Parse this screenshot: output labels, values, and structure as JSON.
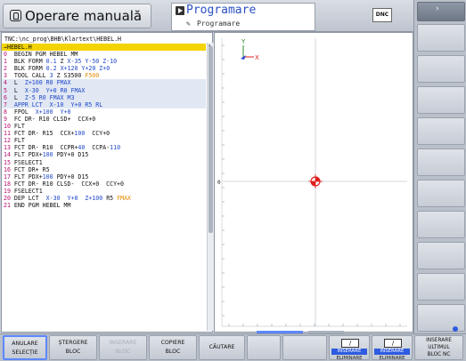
{
  "header": {
    "mode_left_label": "Operare manuală",
    "mode_active_label": "Programare",
    "mode_active_sub": "Programare",
    "dnc_badge": "DNC"
  },
  "program": {
    "path": "TNC:\\nc_prog\\BHB\\Klartext\\HEBEL.H",
    "lines": [
      [
        {
          "t": "→HEBEL.H",
          "c": ""
        }
      ],
      [
        {
          "t": "0  ",
          "c": "n"
        },
        {
          "t": "BEGIN PGM HEBEL MM",
          "c": ""
        }
      ],
      [
        {
          "t": "1  ",
          "c": "n"
        },
        {
          "t": "BLK FORM ",
          "c": ""
        },
        {
          "t": "0.1",
          "c": "v"
        },
        {
          "t": " Z ",
          "c": ""
        },
        {
          "t": "X-35",
          "c": "v"
        },
        {
          "t": " ",
          "c": ""
        },
        {
          "t": "Y-50",
          "c": "v"
        },
        {
          "t": " ",
          "c": ""
        },
        {
          "t": "Z-10",
          "c": "v"
        }
      ],
      [
        {
          "t": "2  ",
          "c": "n"
        },
        {
          "t": "BLK FORM ",
          "c": ""
        },
        {
          "t": "0.2",
          "c": "v"
        },
        {
          "t": " ",
          "c": ""
        },
        {
          "t": "X+120",
          "c": "v"
        },
        {
          "t": " ",
          "c": ""
        },
        {
          "t": "Y+20",
          "c": "v"
        },
        {
          "t": " ",
          "c": ""
        },
        {
          "t": "Z+0",
          "c": "v"
        }
      ],
      [
        {
          "t": "3  ",
          "c": "n"
        },
        {
          "t": "TOOL CALL ",
          "c": ""
        },
        {
          "t": "3",
          "c": "v"
        },
        {
          "t": " Z S3500 ",
          "c": ""
        },
        {
          "t": "F500",
          "c": "f"
        }
      ],
      [
        {
          "t": "4  ",
          "c": "n"
        },
        {
          "t": "L  ",
          "c": ""
        },
        {
          "t": "Z+100",
          "c": "v"
        },
        {
          "t": " R0 FMAX",
          "c": "v"
        }
      ],
      [
        {
          "t": "5  ",
          "c": "n"
        },
        {
          "t": "L  ",
          "c": ""
        },
        {
          "t": "X-30",
          "c": "v"
        },
        {
          "t": "  ",
          "c": ""
        },
        {
          "t": "Y+0",
          "c": "v"
        },
        {
          "t": " R0 FMAX",
          "c": "v"
        }
      ],
      [
        {
          "t": "6  ",
          "c": "n"
        },
        {
          "t": "L  ",
          "c": ""
        },
        {
          "t": "Z-5 R0 FMAX M3",
          "c": "v"
        }
      ],
      [
        {
          "t": "7  ",
          "c": "n"
        },
        {
          "t": "APPR LCT  X-10  Y+0 R5 RL",
          "c": "v"
        }
      ],
      [
        {
          "t": "8  ",
          "c": "n"
        },
        {
          "t": "FPOL  ",
          "c": ""
        },
        {
          "t": "X+100",
          "c": "v"
        },
        {
          "t": "  ",
          "c": ""
        },
        {
          "t": "Y+0",
          "c": "v"
        }
      ],
      [
        {
          "t": "9  ",
          "c": "n"
        },
        {
          "t": "FC DR- R10 CLSD+  CCX+0",
          "c": ""
        }
      ],
      [
        {
          "t": "10 ",
          "c": "n"
        },
        {
          "t": "FLT",
          "c": ""
        }
      ],
      [
        {
          "t": "11 ",
          "c": "n"
        },
        {
          "t": "FCT DR- R15  CCX+",
          "c": ""
        },
        {
          "t": "100",
          "c": "v"
        },
        {
          "t": "  CCY+0",
          "c": ""
        }
      ],
      [
        {
          "t": "12 ",
          "c": "n"
        },
        {
          "t": "FLT",
          "c": ""
        }
      ],
      [
        {
          "t": "13 ",
          "c": "n"
        },
        {
          "t": "FCT DR- R10  CCPR+",
          "c": ""
        },
        {
          "t": "40",
          "c": "v"
        },
        {
          "t": "  CCPA-",
          "c": ""
        },
        {
          "t": "110",
          "c": "v"
        }
      ],
      [
        {
          "t": "14 ",
          "c": "n"
        },
        {
          "t": "FLT PDX+",
          "c": ""
        },
        {
          "t": "100",
          "c": "v"
        },
        {
          "t": " PDY+0 D15",
          "c": ""
        }
      ],
      [
        {
          "t": "15 ",
          "c": "n"
        },
        {
          "t": "FSELECT1",
          "c": ""
        }
      ],
      [
        {
          "t": "16 ",
          "c": "n"
        },
        {
          "t": "FCT DR+ R5",
          "c": ""
        }
      ],
      [
        {
          "t": "17 ",
          "c": "n"
        },
        {
          "t": "FLT PDX+",
          "c": ""
        },
        {
          "t": "100",
          "c": "v"
        },
        {
          "t": " PDY+0 D15",
          "c": ""
        }
      ],
      [
        {
          "t": "18 ",
          "c": "n"
        },
        {
          "t": "FCT DR- R10 CLSD-  CCX+0  CCY+0",
          "c": ""
        }
      ],
      [
        {
          "t": "19 ",
          "c": "n"
        },
        {
          "t": "FSELECT1",
          "c": ""
        }
      ],
      [
        {
          "t": "20 ",
          "c": "n"
        },
        {
          "t": "DEP LCT  ",
          "c": ""
        },
        {
          "t": "X-30",
          "c": "v"
        },
        {
          "t": "  ",
          "c": ""
        },
        {
          "t": "Y+0",
          "c": "v"
        },
        {
          "t": "  ",
          "c": ""
        },
        {
          "t": "Z+100",
          "c": "v"
        },
        {
          "t": " R5 ",
          "c": ""
        },
        {
          "t": "FMAX",
          "c": "f"
        }
      ],
      [
        {
          "t": "21 ",
          "c": "n"
        },
        {
          "t": "END PGM HEBEL MM",
          "c": ""
        }
      ]
    ]
  },
  "graphics": {
    "axis_y_label": "Y",
    "axis_x_label": "X",
    "axis_z_label": "Z",
    "origin_label": "0",
    "colors": {
      "axis_x": "#e02020",
      "axis_y": "#2d8a2d",
      "axis_z": "#2040d0",
      "origin": "#e02020",
      "grid": "#c9cdd3"
    }
  },
  "softkeys": {
    "anulare": [
      "ANULARE",
      "SELECȚIE"
    ],
    "stergere": [
      "ȘTERGERE",
      "BLOC"
    ],
    "inserare_disabled": [
      "INSERARE",
      "BLOC"
    ],
    "copiere": [
      "COPIERE",
      "BLOC"
    ],
    "cautare": [
      "CĂUTARE"
    ],
    "ins_elim_1": [
      "INSERARE",
      "ELIMINARE"
    ],
    "ins_elim_2": [
      "INSERARE",
      "ELIMINARE"
    ],
    "inserare_ultimul": [
      "INSERARE",
      "ULTIMUL",
      "BLOC NC"
    ]
  }
}
